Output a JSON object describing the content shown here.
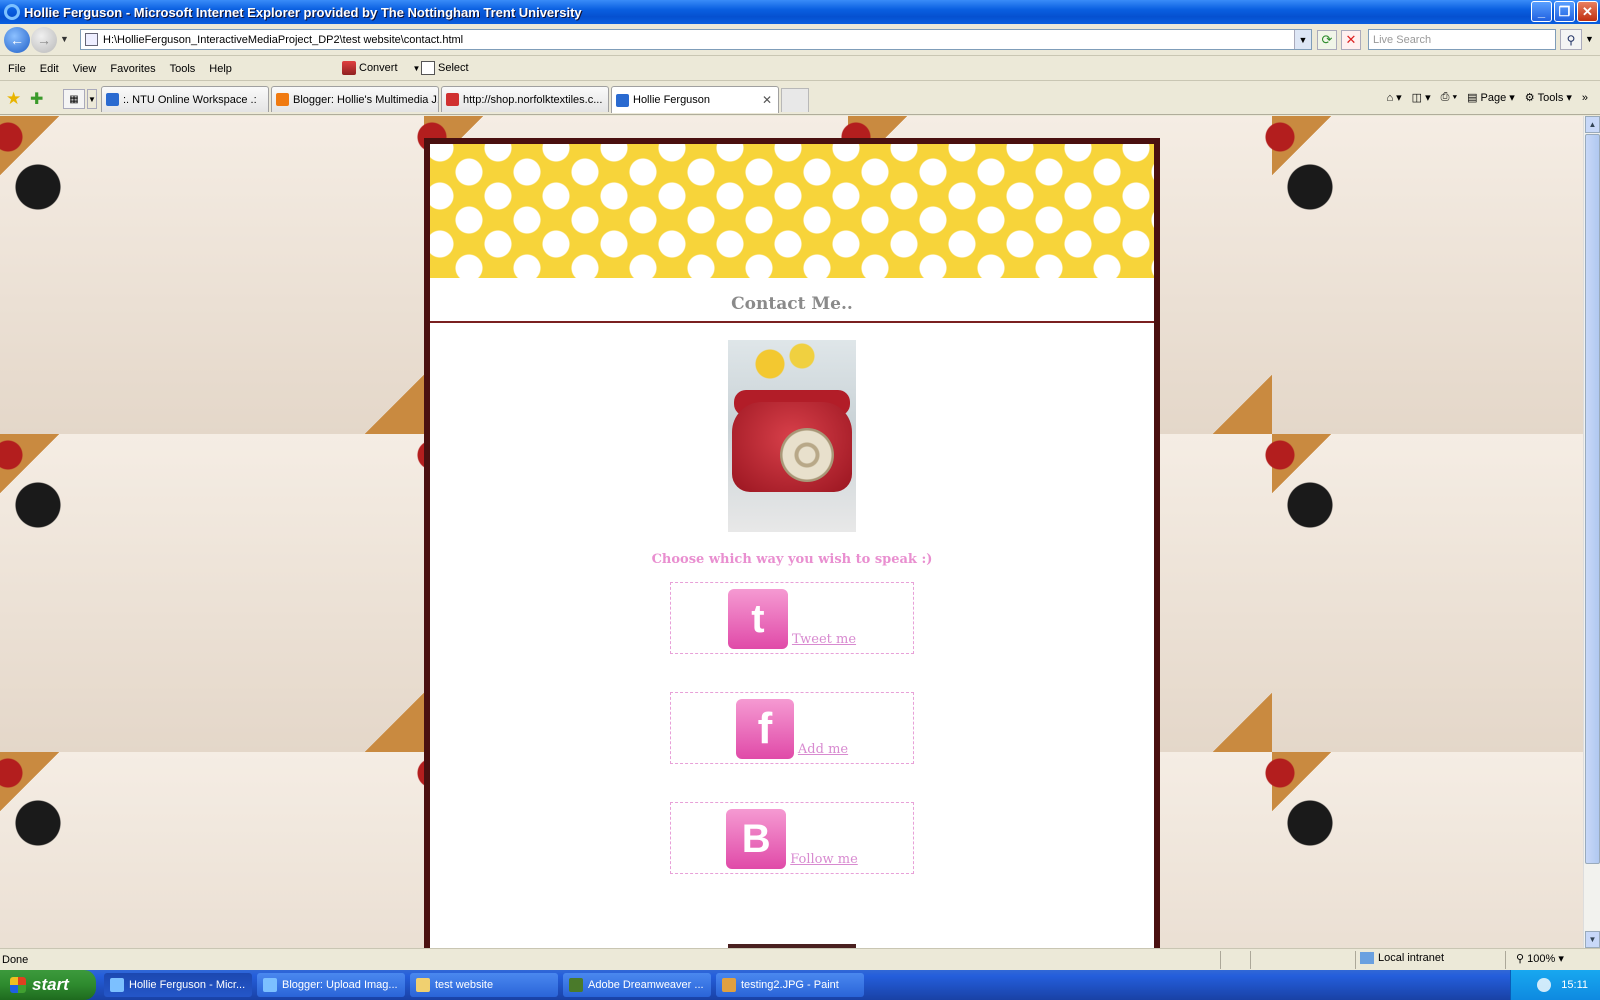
{
  "window": {
    "title": "Hollie Ferguson - Microsoft Internet Explorer provided by The Nottingham Trent University"
  },
  "address": {
    "url": "H:\\HollieFerguson_InteractiveMediaProject_DP2\\test website\\contact.html",
    "search_placeholder": "Live Search"
  },
  "menu": {
    "items": [
      "File",
      "Edit",
      "View",
      "Favorites",
      "Tools",
      "Help"
    ],
    "convert_label": "Convert",
    "select_label": "Select"
  },
  "tabs": [
    {
      "label": ":. NTU Online Workspace .:",
      "color": "#2a6ad0"
    },
    {
      "label": "Blogger: Hollie's Multimedia J...",
      "color": "#f07a10"
    },
    {
      "label": "http://shop.norfolktextiles.c...",
      "color": "#d03030"
    },
    {
      "label": "Hollie Ferguson",
      "color": "#2a6ad0",
      "active": true
    }
  ],
  "command_bar": {
    "page_label": "Page",
    "tools_label": "Tools"
  },
  "page": {
    "heading": "Contact Me..",
    "prompt": "Choose which way you wish to speak :)",
    "links": [
      {
        "icon": "twitter-icon",
        "glyph": "t",
        "label": "Tweet me"
      },
      {
        "icon": "facebook-icon",
        "glyph": "f",
        "label": "Add me"
      },
      {
        "icon": "blogger-icon",
        "glyph": "B",
        "label": "Follow me"
      }
    ],
    "colors": {
      "banner": "#f7d43a",
      "frame": "#4a1010",
      "accent_pink": "#e98fd0",
      "heading_grey": "#8a8a8a"
    }
  },
  "status": {
    "text": "Done",
    "zone": "Local intranet",
    "zoom": "100%"
  },
  "taskbar": {
    "start_label": "start",
    "buttons": [
      {
        "label": "Hollie Ferguson - Micr...",
        "active": true,
        "color": "#7cc0ff"
      },
      {
        "label": "Blogger: Upload Imag...",
        "active": false,
        "color": "#7cc0ff"
      },
      {
        "label": "test website",
        "active": false,
        "color": "#f0d070"
      },
      {
        "label": "Adobe Dreamweaver ...",
        "active": false,
        "color": "#4a7a2a"
      },
      {
        "label": "testing2.JPG - Paint",
        "active": false,
        "color": "#e0a040"
      }
    ],
    "clock": "15:11"
  }
}
